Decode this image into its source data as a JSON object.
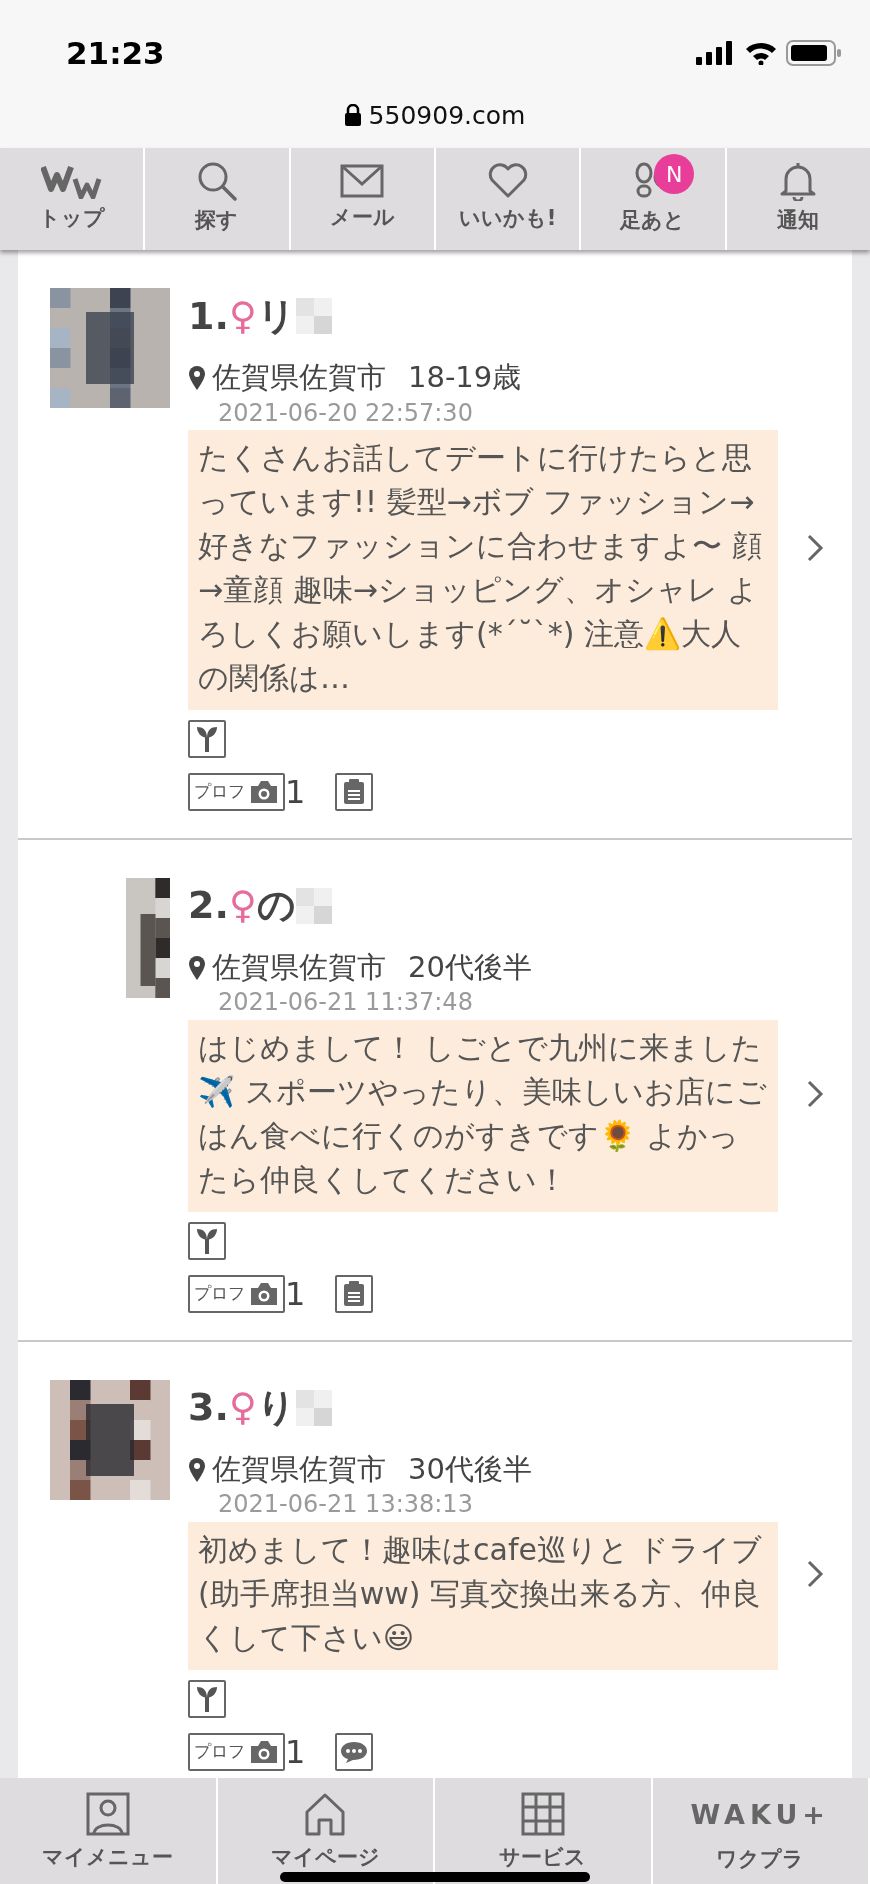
{
  "status_bar": {
    "time": "21:23"
  },
  "address_bar": {
    "url": "550909.com"
  },
  "top_nav": [
    {
      "kind": "logo",
      "label": "トップ"
    },
    {
      "kind": "search",
      "label": "探す"
    },
    {
      "kind": "mail",
      "label": "メール"
    },
    {
      "kind": "heart",
      "label": "いいかも!"
    },
    {
      "kind": "footprints",
      "label": "足あと",
      "badge": "N"
    },
    {
      "kind": "bell",
      "label": "通知"
    }
  ],
  "profiles": [
    {
      "rank": "1.",
      "gender": "♀",
      "name": "リ",
      "location": "佐賀県佐賀市",
      "age": "18-19歳",
      "date": "2021-06-20 22:57:30",
      "message": "たくさんお話してデートに行けたらと思っています!! 髪型→ボブ ファッション→好きなファッションに合わせますよ〜 顔→童顔 趣味→ショッピング、オシャレ よろしくお願いします(*´˘`*) 注意⚠️大人の関係は…",
      "prof_tag": "プロフ",
      "photo_count": "1",
      "info_tag": {
        "kind": "note"
      }
    },
    {
      "rank": "2.",
      "gender": "♀",
      "name": "の",
      "location": "佐賀県佐賀市",
      "age": "20代後半",
      "date": "2021-06-21 11:37:48",
      "message": "はじめまして！ しごとで九州に来ました✈️ スポーツやったり、美味しいお店にごはん食べに行くのがすきです🌻 よかったら仲良くしてください！",
      "prof_tag": "プロフ",
      "photo_count": "1",
      "info_tag": {
        "kind": "note"
      }
    },
    {
      "rank": "3.",
      "gender": "♀",
      "name": "り",
      "location": "佐賀県佐賀市",
      "age": "30代後半",
      "date": "2021-06-21 13:38:13",
      "message": "初めまして！趣味はcafe巡りと ドライブ(助手席担当ww) 写真交換出来る方、仲良くして下さい😃",
      "prof_tag": "プロフ",
      "photo_count": "1",
      "info_tag": {
        "kind": "chat"
      }
    }
  ],
  "bottom_nav": [
    {
      "kind": "person",
      "label": "マイメニュー"
    },
    {
      "kind": "home",
      "label": "マイページ"
    },
    {
      "kind": "grid",
      "label": "サービス"
    },
    {
      "kind": "logo",
      "logo_text": "WAKU+",
      "label": "ワクプラ"
    }
  ]
}
